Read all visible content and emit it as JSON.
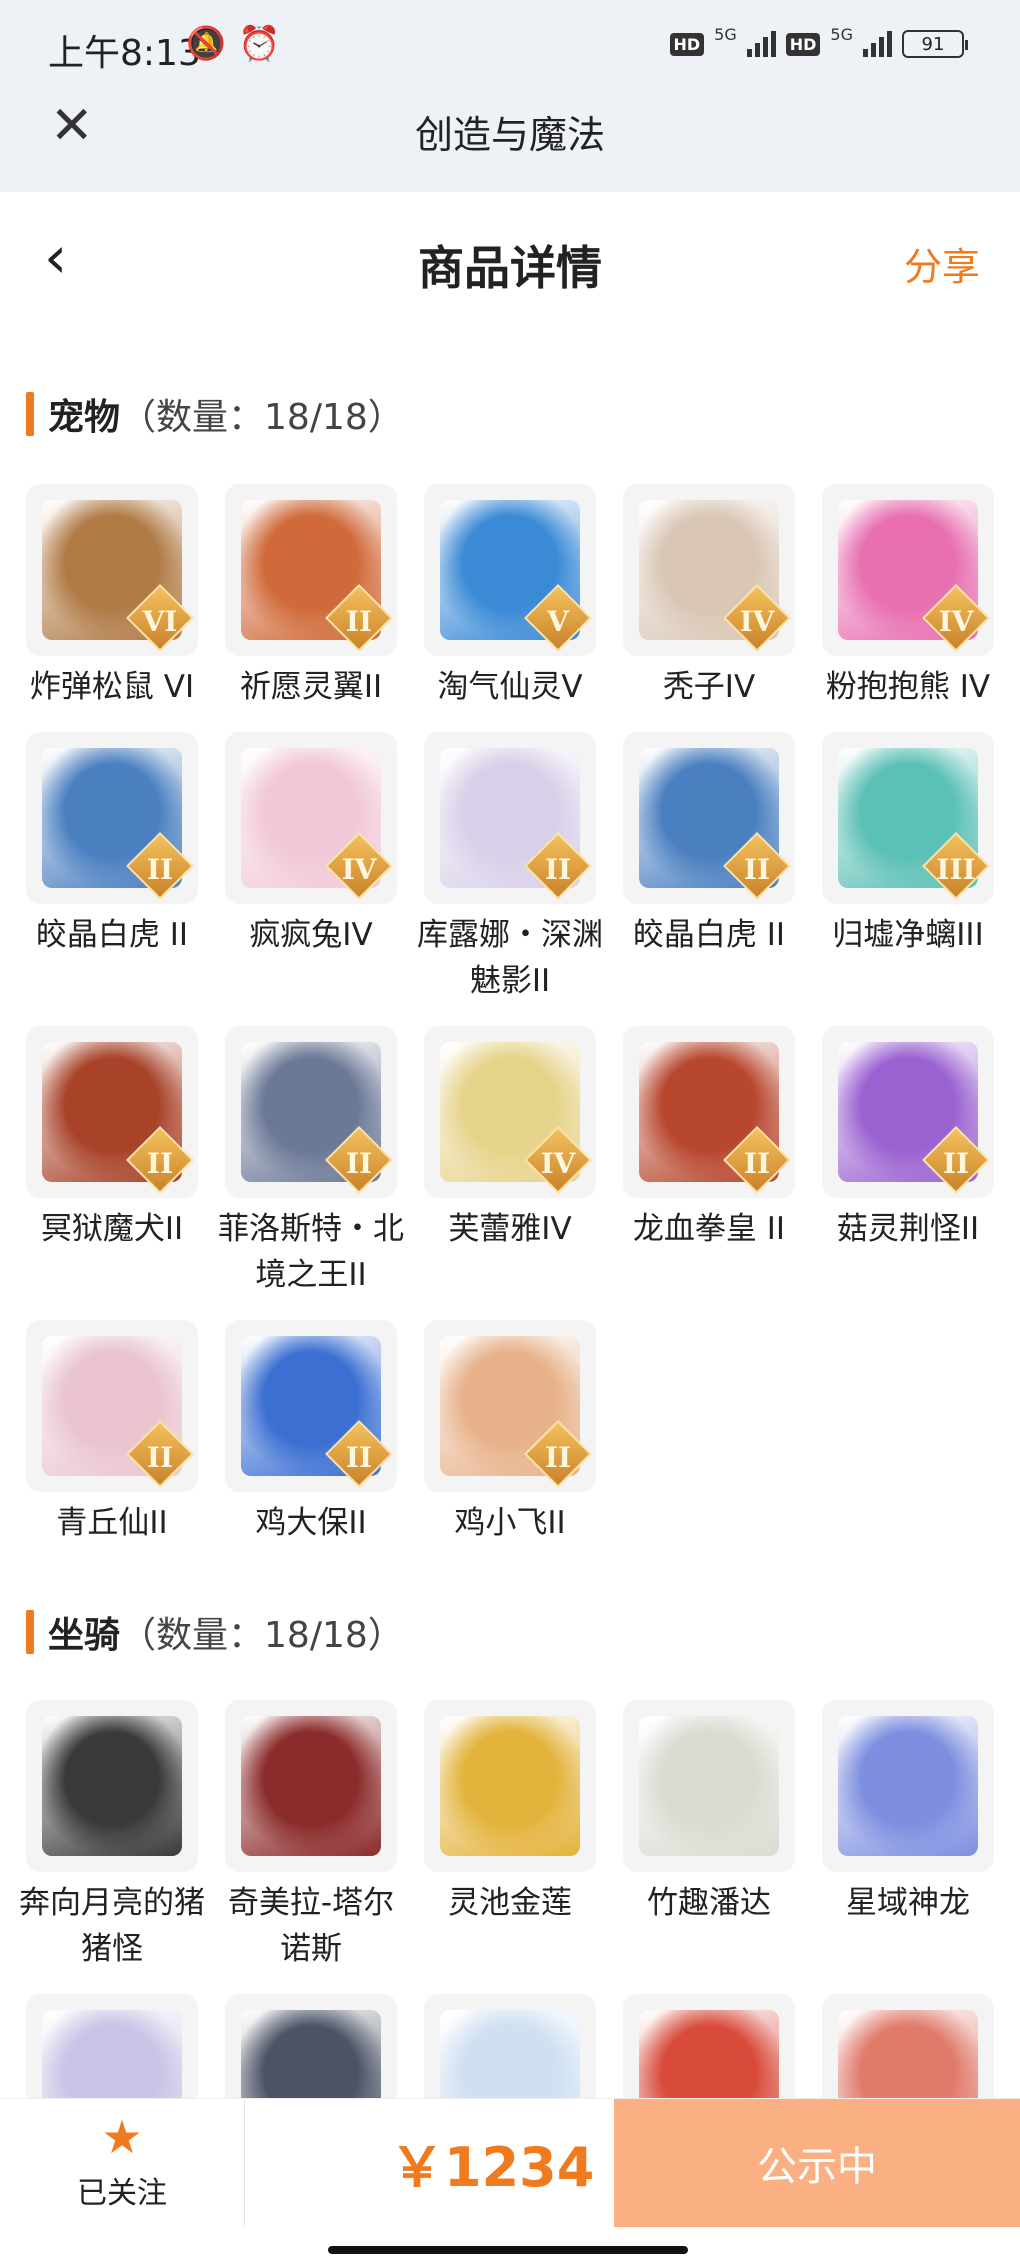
{
  "status_bar": {
    "time": "上午8:13",
    "network": "5G",
    "battery": "91"
  },
  "app": {
    "title": "创造与魔法"
  },
  "header": {
    "title": "商品详情",
    "share": "分享"
  },
  "sections": [
    {
      "name": "宠物",
      "count": "（数量：18/18）",
      "items": [
        {
          "label": "炸弹松鼠 VI",
          "rank": "VI",
          "color": "#b07a45"
        },
        {
          "label": "祈愿灵翼II",
          "rank": "II",
          "color": "#d06a3a"
        },
        {
          "label": "淘气仙灵V",
          "rank": "V",
          "color": "#3a8ad6"
        },
        {
          "label": "秃子IV",
          "rank": "IV",
          "color": "#d9c6b4"
        },
        {
          "label": "粉抱抱熊 IV",
          "rank": "IV",
          "color": "#e86fb0"
        },
        {
          "label": "皎晶白虎 II",
          "rank": "II",
          "color": "#4a7fc0"
        },
        {
          "label": "疯疯兔IV",
          "rank": "IV",
          "color": "#f1c8d8"
        },
        {
          "label": "库露娜・深渊魅影II",
          "rank": "II",
          "color": "#d9cfe8"
        },
        {
          "label": "皎晶白虎 II",
          "rank": "II",
          "color": "#4a7fc0"
        },
        {
          "label": "归墟净螭III",
          "rank": "III",
          "color": "#5bc0b5"
        },
        {
          "label": "冥狱魔犬II",
          "rank": "II",
          "color": "#a8432a"
        },
        {
          "label": "菲洛斯特・北境之王II",
          "rank": "II",
          "color": "#6b7896"
        },
        {
          "label": "芙蕾雅IV",
          "rank": "IV",
          "color": "#e6d38a"
        },
        {
          "label": "龙血拳皇 II",
          "rank": "II",
          "color": "#b8472f"
        },
        {
          "label": "菇灵荆怪II",
          "rank": "II",
          "color": "#9a62d1"
        },
        {
          "label": "青丘仙II",
          "rank": "II",
          "color": "#e9c4cf"
        },
        {
          "label": "鸡大保II",
          "rank": "II",
          "color": "#3b6fd2"
        },
        {
          "label": "鸡小飞II",
          "rank": "II",
          "color": "#e7b28a"
        }
      ]
    },
    {
      "name": "坐骑",
      "count": "（数量：18/18）",
      "items": [
        {
          "label": "奔向月亮的猪猪怪",
          "rank": "",
          "color": "#3a3a3a"
        },
        {
          "label": "奇美拉-塔尔诺斯",
          "rank": "",
          "color": "#8b2b2b"
        },
        {
          "label": "灵池金莲",
          "rank": "",
          "color": "#e3b33c"
        },
        {
          "label": "竹趣潘达",
          "rank": "",
          "color": "#d9dcd2"
        },
        {
          "label": "星域神龙",
          "rank": "",
          "color": "#7e8fe0"
        },
        {
          "label": "",
          "rank": "",
          "color": "#c9c3e6"
        },
        {
          "label": "",
          "rank": "",
          "color": "#4b5365"
        },
        {
          "label": "",
          "rank": "",
          "color": "#cfe0f2"
        },
        {
          "label": "",
          "rank": "",
          "color": "#d84a3a"
        },
        {
          "label": "",
          "rank": "",
          "color": "#e07a6a"
        }
      ]
    }
  ],
  "bottom_bar": {
    "follow_label": "已关注",
    "price": "￥1234",
    "status_label": "公示中"
  }
}
